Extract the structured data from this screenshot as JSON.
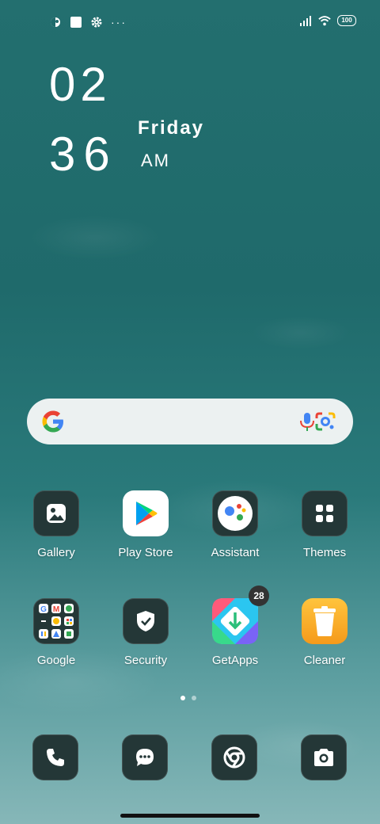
{
  "status_bar": {
    "icons_left": [
      "app-notification-icon",
      "square-notification-icon",
      "settings-icon"
    ],
    "more": "···",
    "icons_right": [
      "signal-icon",
      "wifi-icon"
    ],
    "battery": "100"
  },
  "clock": {
    "hour": "02",
    "minute": "36",
    "day": "Friday",
    "ampm": "AM"
  },
  "search": {
    "icons": [
      "google-icon",
      "mic-icon",
      "lens-icon"
    ]
  },
  "apps": [
    {
      "label": "Gallery",
      "icon": "gallery-icon"
    },
    {
      "label": "Play Store",
      "icon": "play-store-icon"
    },
    {
      "label": "Assistant",
      "icon": "assistant-icon"
    },
    {
      "label": "Themes",
      "icon": "themes-icon"
    },
    {
      "label": "Google",
      "icon": "google-folder-icon"
    },
    {
      "label": "Security",
      "icon": "security-icon"
    },
    {
      "label": "GetApps",
      "icon": "getapps-icon",
      "badge": "28"
    },
    {
      "label": "Cleaner",
      "icon": "cleaner-icon"
    }
  ],
  "pages": {
    "count": 2,
    "active": 0
  },
  "dock": [
    {
      "icon": "phone-icon"
    },
    {
      "icon": "messages-icon"
    },
    {
      "icon": "chrome-icon"
    },
    {
      "icon": "camera-icon"
    }
  ],
  "colors": {
    "wallpaper": "#236f6f",
    "dark_icon_bg": "#243737",
    "search_bg": "#ecf1f1",
    "cleaner": "#f5a623"
  }
}
